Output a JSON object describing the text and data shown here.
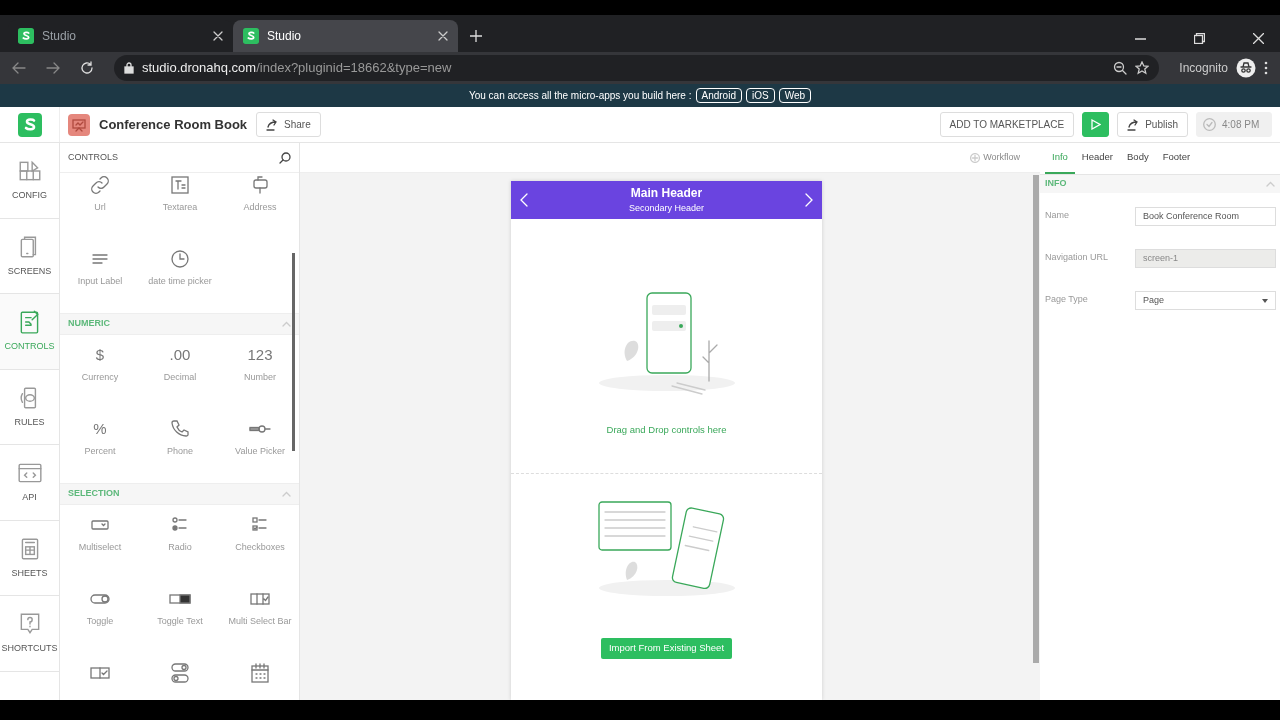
{
  "browser": {
    "tabs": [
      {
        "title": "Studio",
        "selected": false
      },
      {
        "title": "Studio",
        "selected": true
      }
    ],
    "url_host": "studio.dronahq.com",
    "url_path": "/index?pluginid=18662&type=new",
    "profile": "Incognito"
  },
  "banner": {
    "text": "You can access all the micro-apps you build here :",
    "links": [
      "Android",
      "iOS",
      "Web"
    ]
  },
  "app_header": {
    "title": "Conference Room Book",
    "share": "Share",
    "marketplace": "ADD TO MARKETPLACE",
    "publish": "Publish",
    "saved_time": "4:08 PM"
  },
  "rail": [
    {
      "label": "CONFIG",
      "selected": false
    },
    {
      "label": "SCREENS",
      "selected": false
    },
    {
      "label": "CONTROLS",
      "selected": true
    },
    {
      "label": "RULES",
      "selected": false
    },
    {
      "label": "API",
      "selected": false
    },
    {
      "label": "SHEETS",
      "selected": false
    },
    {
      "label": "SHORTCUTS",
      "selected": false
    }
  ],
  "controls_panel": {
    "title": "CONTROLS",
    "sections": [
      {
        "items": [
          {
            "label": "Url"
          },
          {
            "label": "Textarea"
          },
          {
            "label": "Address"
          },
          {
            "label": "Input Label"
          },
          {
            "label": "date time picker"
          }
        ]
      },
      {
        "title": "NUMERIC",
        "expanded": true,
        "items": [
          {
            "label": "Currency",
            "glyph": "$"
          },
          {
            "label": "Decimal",
            "glyph": ".00"
          },
          {
            "label": "Number",
            "glyph": "123"
          },
          {
            "label": "Percent",
            "glyph": "%"
          },
          {
            "label": "Phone"
          },
          {
            "label": "Value Picker"
          }
        ]
      },
      {
        "title": "SELECTION",
        "expanded": true,
        "items": [
          {
            "kind": "labeled",
            "label": "Multiselect"
          },
          {
            "kind": "labeled",
            "label": "Radio"
          },
          {
            "kind": "labeled",
            "label": "Checkboxes"
          },
          {
            "kind": "labeled",
            "label": "Toggle"
          },
          {
            "kind": "labeled",
            "label": "Toggle Text"
          },
          {
            "kind": "labeled",
            "label": "Multi Select Bar"
          },
          {
            "kind": "icon_only"
          },
          {
            "kind": "icon_only"
          },
          {
            "kind": "icon_only"
          }
        ]
      }
    ]
  },
  "canvas": {
    "workflow": "Workflow",
    "screen": {
      "main_header": "Main Header",
      "secondary_header": "Secondary Header",
      "drop_hint": "Drag and Drop controls here",
      "import_button": "Import From Existing Sheet"
    }
  },
  "properties": {
    "tabs": [
      {
        "label": "Info",
        "selected": true
      },
      {
        "label": "Header",
        "selected": false
      },
      {
        "label": "Body",
        "selected": false
      },
      {
        "label": "Footer",
        "selected": false
      }
    ],
    "section": "INFO",
    "fields": [
      {
        "label": "Name",
        "kind": "text",
        "value": "Book Conference Room",
        "disabled": false
      },
      {
        "label": "Navigation URL",
        "kind": "text",
        "value": "screen-1",
        "disabled": true
      },
      {
        "label": "Page Type",
        "kind": "select",
        "value": "Page",
        "disabled": false
      }
    ]
  }
}
